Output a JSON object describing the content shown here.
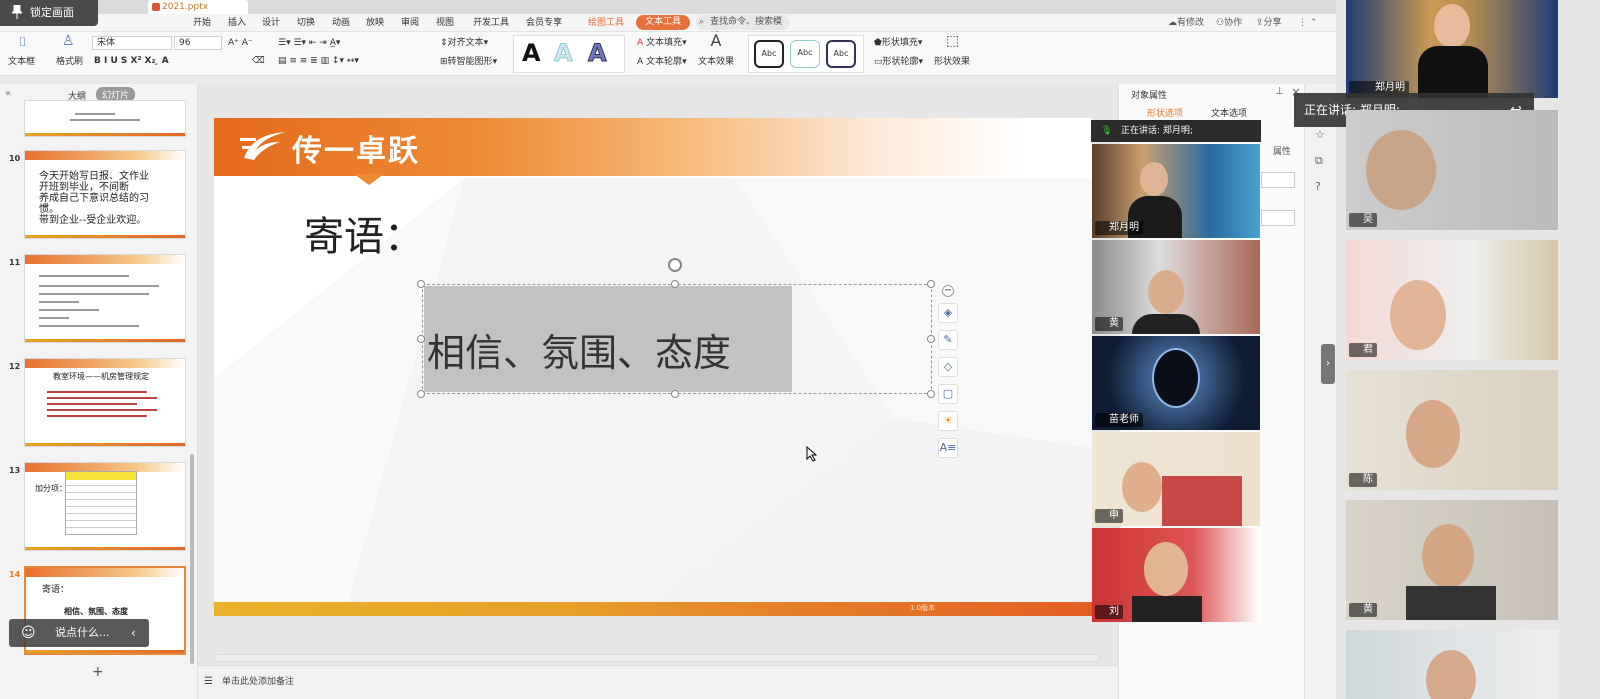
{
  "window": {
    "lock_button": "锁定画面",
    "doc_tab": "2021.pptx"
  },
  "menu": {
    "items": [
      "开始",
      "插入",
      "设计",
      "切换",
      "动画",
      "放映",
      "审阅",
      "视图",
      "开发工具",
      "会员专享"
    ],
    "drawing_tools": "绘图工具",
    "text_tools": "文本工具",
    "search_placeholder": "查找命令、搜索模板",
    "right": [
      "有修改",
      "协作",
      "分享"
    ]
  },
  "ribbon": {
    "textbox": "文本框",
    "format_painter": "格式刷",
    "font_name": "宋体",
    "font_size": "96",
    "align_text": "对齐文本",
    "smart_shape": "转智能图形",
    "text_fill": "文本填充",
    "text_outline": "文本轮廓",
    "text_effect": "文本效果",
    "shape_fill": "形状填充",
    "shape_outline": "形状轮廓",
    "shape_effect": "形状效果",
    "style_sample": "Abc",
    "big_a": "A"
  },
  "left_panel": {
    "tab_outline": "大纲",
    "tab_slides": "幻灯片",
    "slide_numbers": [
      "10",
      "11",
      "12",
      "13",
      "14"
    ],
    "slide10_text": [
      "今天开始写日报、文作业",
      "开班到毕业，不间断",
      "养成自己下意识总结的习",
      "惯。",
      "带到企业--受企业欢迎。"
    ],
    "slide12_title": "教室环境——机房管理规定",
    "slide13_label": "加分项：",
    "slide14_title": "寄语：",
    "slide14_text": "相信、氛围、态度",
    "thumb_logo": "传一卓跃",
    "add_slide": "+"
  },
  "slide": {
    "logo": "传一卓跃",
    "title": "寄语：",
    "body": "相信、氛围、态度",
    "footer_tag": "1.0版本"
  },
  "notes": {
    "placeholder": "单击此处添加备注"
  },
  "prop_panel": {
    "title": "对象属性",
    "tab_shape": "形状选项",
    "tab_text": "文本选项",
    "partial": "属性"
  },
  "video_panel": {
    "speaking": "正在讲话: 郑月明;",
    "tiles": [
      "郑月明",
      "黄",
      "苗老师",
      "申",
      "刘"
    ]
  },
  "right_strip": {
    "top_name": "郑月明",
    "speaker_tag": "正在讲话: 郑月明;",
    "names": [
      "吴",
      "君",
      "陈",
      "黄"
    ]
  },
  "chat": {
    "placeholder": "说点什么..."
  },
  "colors": {
    "accent": "#e8703a",
    "slide_header": "#e56a1c",
    "footer_yellow": "#eab22b"
  }
}
